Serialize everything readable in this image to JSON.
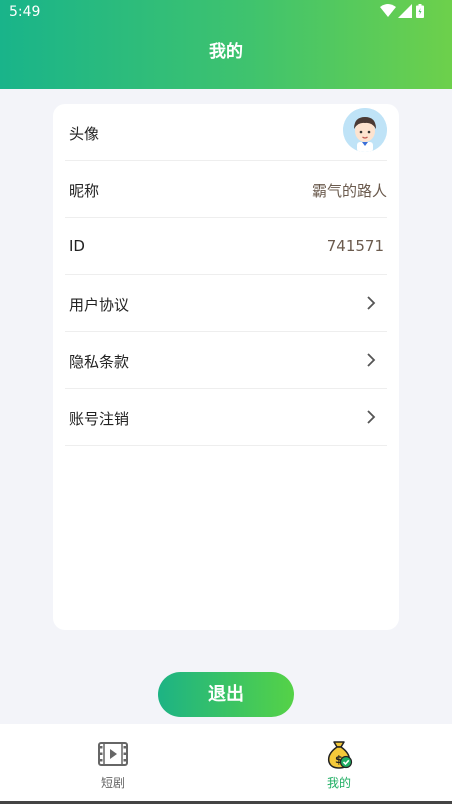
{
  "status_bar": {
    "time": "5:49"
  },
  "header": {
    "title": "我的"
  },
  "profile": {
    "rows": [
      {
        "label": "头像",
        "type": "avatar"
      },
      {
        "label": "昵称",
        "value": "霸气的路人"
      },
      {
        "label": "ID",
        "value": "741571"
      },
      {
        "label": "用户协议",
        "type": "link"
      },
      {
        "label": "隐私条款",
        "type": "link"
      },
      {
        "label": "账号注销",
        "type": "link"
      }
    ]
  },
  "logout": {
    "label": "退出"
  },
  "tabbar": {
    "tabs": [
      {
        "label": "短剧",
        "icon": "film-icon",
        "active": false
      },
      {
        "label": "我的",
        "icon": "money-bag-icon",
        "active": true
      }
    ],
    "active_color": "#1fae63",
    "inactive_color": "#666666"
  },
  "colors": {
    "header_gradient_start": "#19b48a",
    "header_gradient_end": "#6dd04b",
    "background": "#f3f4f9"
  }
}
